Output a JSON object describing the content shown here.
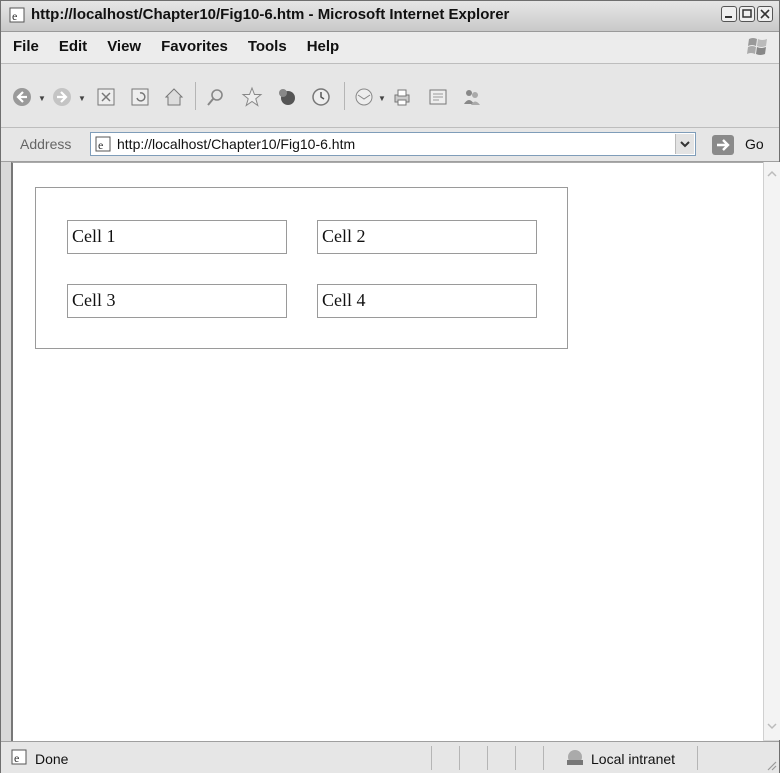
{
  "window": {
    "title": "http://localhost/Chapter10/Fig10-6.htm - Microsoft Internet Explorer"
  },
  "menu": [
    "File",
    "Edit",
    "View",
    "Favorites",
    "Tools",
    "Help"
  ],
  "toolbar": {
    "icons": [
      "back-icon",
      "forward-icon",
      "stop-icon",
      "refresh-icon",
      "home-icon",
      "search-icon",
      "favorites-icon",
      "media-icon",
      "history-icon",
      "mail-icon",
      "print-icon",
      "edit-icon",
      "messenger-icon"
    ]
  },
  "address": {
    "label": "Address",
    "url": "http://localhost/Chapter10/Fig10-6.htm",
    "go_label": "Go"
  },
  "table": {
    "cells": [
      [
        "Cell 1",
        "Cell 2"
      ],
      [
        "Cell 3",
        "Cell 4"
      ]
    ]
  },
  "status": {
    "text": "Done",
    "zone": "Local intranet"
  }
}
